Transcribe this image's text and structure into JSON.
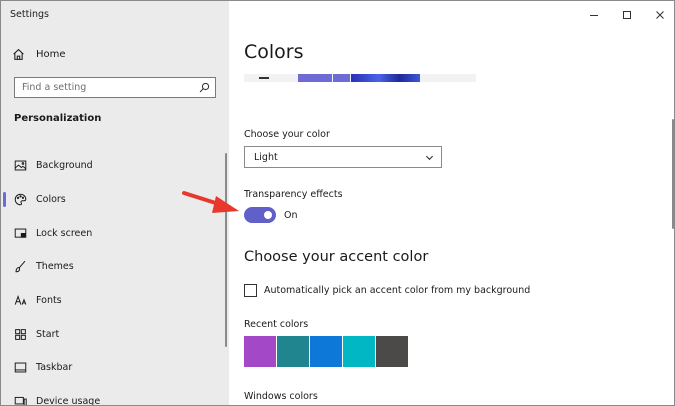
{
  "app": {
    "title": "Settings"
  },
  "sidebar": {
    "home_label": "Home",
    "search_placeholder": "Find a setting",
    "section_title": "Personalization",
    "items": [
      {
        "label": "Background",
        "icon": "background-icon",
        "active": false
      },
      {
        "label": "Colors",
        "icon": "palette-icon",
        "active": true
      },
      {
        "label": "Lock screen",
        "icon": "lock-screen-icon",
        "active": false
      },
      {
        "label": "Themes",
        "icon": "brush-icon",
        "active": false
      },
      {
        "label": "Fonts",
        "icon": "font-icon",
        "active": false
      },
      {
        "label": "Start",
        "icon": "start-icon",
        "active": false
      },
      {
        "label": "Taskbar",
        "icon": "taskbar-icon",
        "active": false
      },
      {
        "label": "Device usage",
        "icon": "device-usage-icon",
        "active": false
      }
    ]
  },
  "main": {
    "page_title": "Colors",
    "choose_color_label": "Choose your color",
    "choose_color_value": "Light",
    "transparency_label": "Transparency effects",
    "transparency_state": "On",
    "accent_heading": "Choose your accent color",
    "auto_accent_label": "Automatically pick an accent color from my background",
    "auto_accent_checked": false,
    "recent_colors_label": "Recent colors",
    "recent_colors": [
      "#a349c7",
      "#218590",
      "#0d78d8",
      "#00b7c3",
      "#4c4a48"
    ],
    "windows_colors_label": "Windows colors"
  },
  "colors": {
    "accent": "#6160c9",
    "annotation_arrow": "#e8382e",
    "sidebar_bg": "#ebebeb"
  }
}
